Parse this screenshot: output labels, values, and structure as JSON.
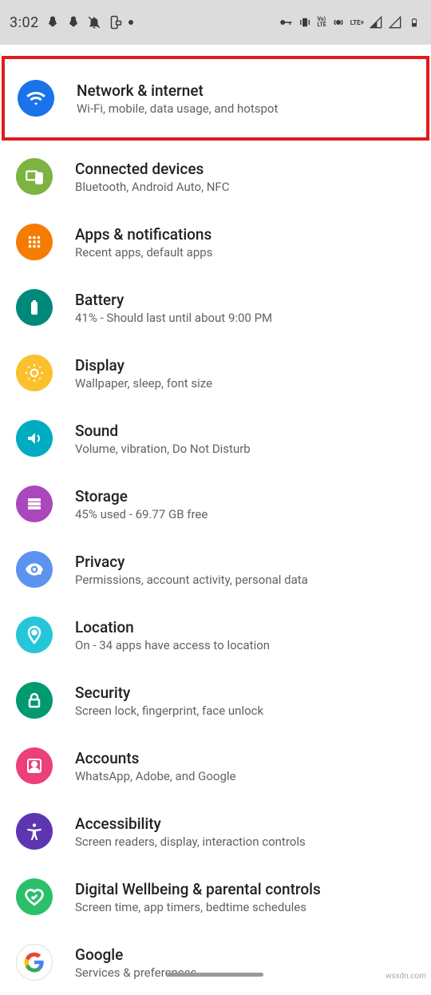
{
  "status": {
    "time": "3:02",
    "lte": "LTE+",
    "volte": "Vo)\nLTE"
  },
  "items": [
    {
      "title": "Network & internet",
      "sub": "Wi-Fi, mobile, data usage, and hotspot",
      "icon": "wifi-icon",
      "color": "#1a73e8",
      "highlight": true
    },
    {
      "title": "Connected devices",
      "sub": "Bluetooth, Android Auto, NFC",
      "icon": "devices-icon",
      "color": "#7cb342",
      "highlight": false
    },
    {
      "title": "Apps & notifications",
      "sub": "Recent apps, default apps",
      "icon": "apps-icon",
      "color": "#f57c00",
      "highlight": false
    },
    {
      "title": "Battery",
      "sub": "41% - Should last until about 9:00 PM",
      "icon": "battery-icon",
      "color": "#00897b",
      "highlight": false
    },
    {
      "title": "Display",
      "sub": "Wallpaper, sleep, font size",
      "icon": "display-icon",
      "color": "#fbc02d",
      "highlight": false
    },
    {
      "title": "Sound",
      "sub": "Volume, vibration, Do Not Disturb",
      "icon": "sound-icon",
      "color": "#00acc1",
      "highlight": false
    },
    {
      "title": "Storage",
      "sub": "45% used - 69.77 GB free",
      "icon": "storage-icon",
      "color": "#ab47bc",
      "highlight": false
    },
    {
      "title": "Privacy",
      "sub": "Permissions, account activity, personal data",
      "icon": "privacy-icon",
      "color": "#5c93ee",
      "highlight": false
    },
    {
      "title": "Location",
      "sub": "On - 34 apps have access to location",
      "icon": "location-icon",
      "color": "#26c6da",
      "highlight": false
    },
    {
      "title": "Security",
      "sub": "Screen lock, fingerprint, face unlock",
      "icon": "security-icon",
      "color": "#009970",
      "highlight": false
    },
    {
      "title": "Accounts",
      "sub": "WhatsApp, Adobe, and Google",
      "icon": "accounts-icon",
      "color": "#ec407a",
      "highlight": false
    },
    {
      "title": "Accessibility",
      "sub": "Screen readers, display, interaction controls",
      "icon": "accessibility-icon",
      "color": "#5e35b1",
      "highlight": false
    },
    {
      "title": "Digital Wellbeing & parental controls",
      "sub": "Screen time, app timers, bedtime schedules",
      "icon": "wellbeing-icon",
      "color": "#2bbf6a",
      "highlight": false
    },
    {
      "title": "Google",
      "sub": "Services & preferences",
      "icon": "google-icon",
      "color": "#ffffff",
      "highlight": false
    }
  ],
  "watermark": "wsxdn.com"
}
